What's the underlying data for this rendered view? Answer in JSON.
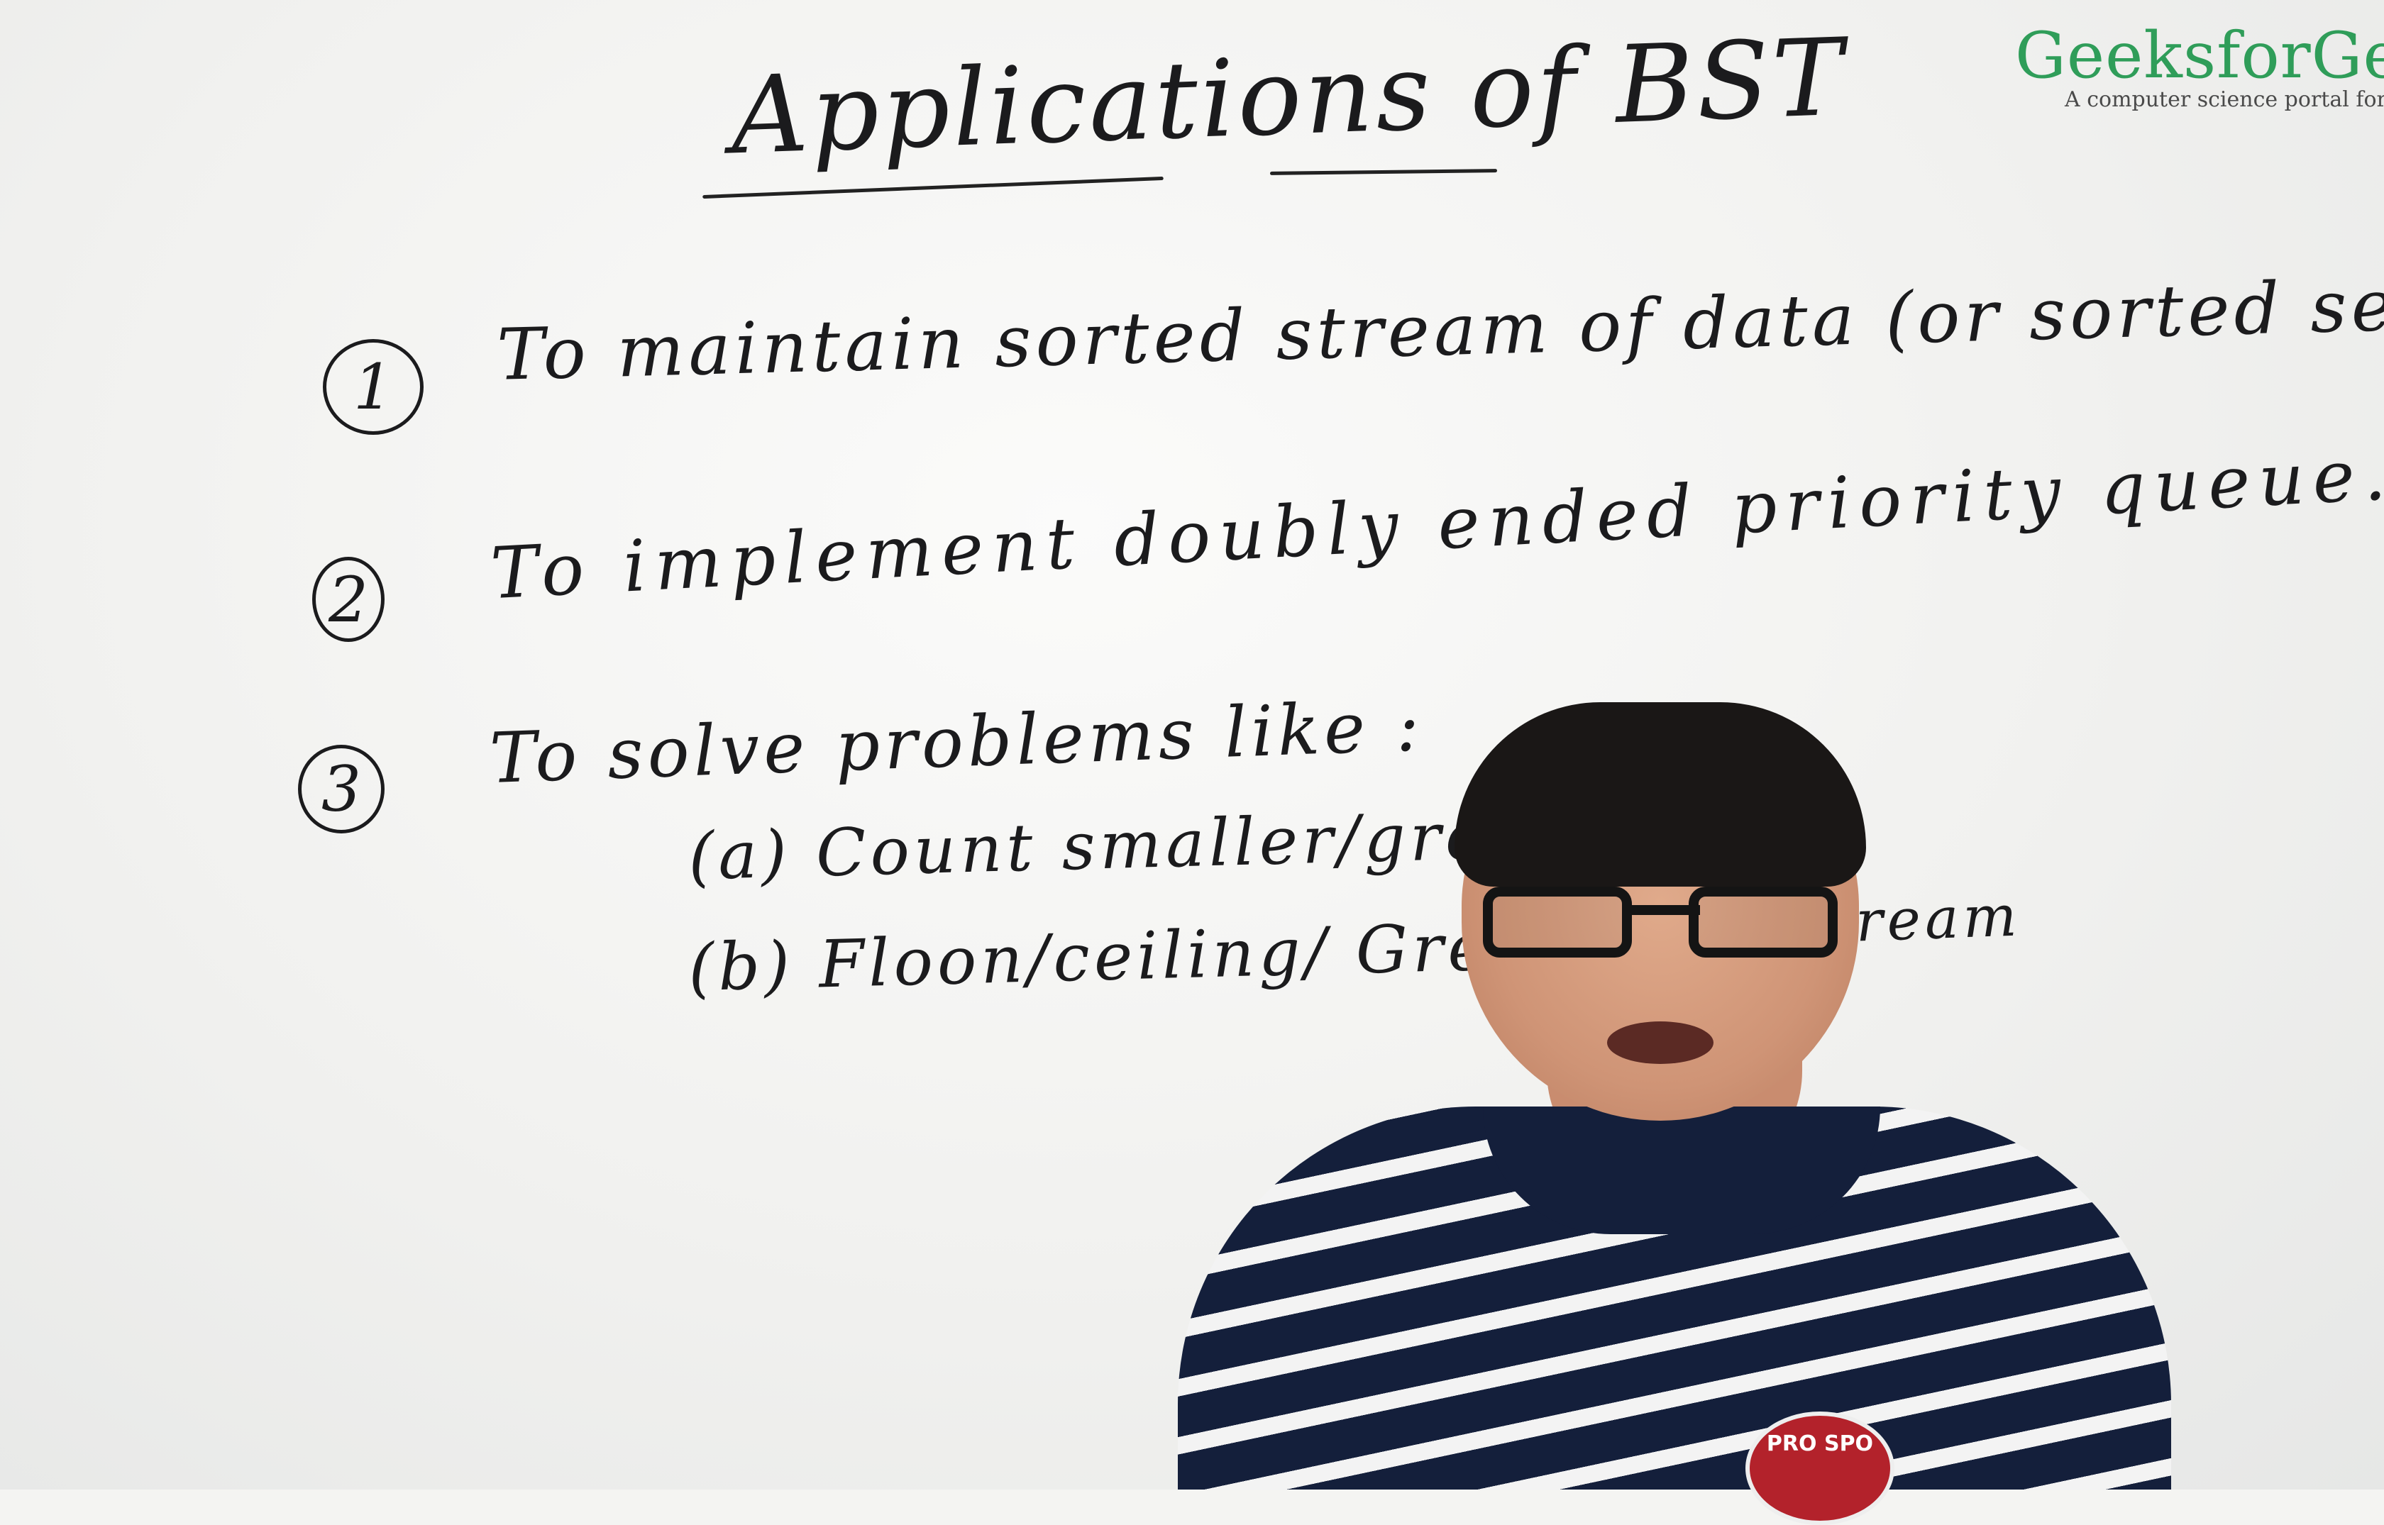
{
  "board": {
    "title": "Applications of BST",
    "items": [
      {
        "number": "1",
        "text": "To maintain sorted stream of data (or sorted set of data)"
      },
      {
        "number": "2",
        "text": "To implement doubly ended priority queue."
      },
      {
        "number": "3",
        "text": "To solve problems like :"
      }
    ],
    "subitems": [
      {
        "label": "(a)",
        "text": "Count smaller/greater in"
      },
      {
        "label": "(b)",
        "text": "Floon/ceiling/ Greater/smal"
      }
    ],
    "subitem_a_tail": "stream"
  },
  "logo": {
    "brand": "GeeksforGee",
    "tagline": "A computer science portal for g",
    "brand_color": "#2f9d59"
  },
  "presenter": {
    "shirt_badge_text": "PRO SPO"
  }
}
